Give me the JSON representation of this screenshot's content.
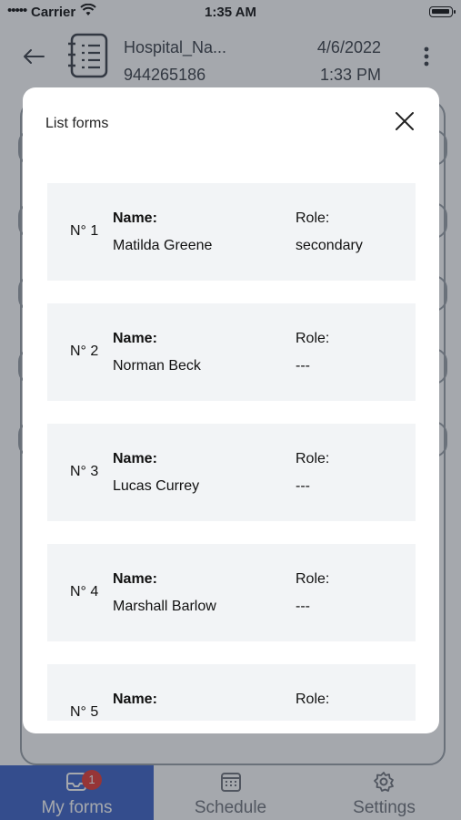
{
  "status_bar": {
    "carrier": "Carrier",
    "time": "1:35 AM"
  },
  "header": {
    "name": "Hospital_Na...",
    "id": "944265186",
    "date": "4/6/2022",
    "time": "1:33 PM"
  },
  "modal": {
    "title": "List forms",
    "items": [
      {
        "number": "N° 1",
        "name_label": "Name:",
        "name": "Matilda  Greene",
        "role_label": "Role:",
        "role": "secondary"
      },
      {
        "number": "N° 2",
        "name_label": "Name:",
        "name": "Norman Beck",
        "role_label": "Role:",
        "role": "---"
      },
      {
        "number": "N° 3",
        "name_label": "Name:",
        "name": "Lucas  Currey",
        "role_label": "Role:",
        "role": "---"
      },
      {
        "number": "N° 4",
        "name_label": "Name:",
        "name": "Marshall  Barlow",
        "role_label": "Role:",
        "role": "---"
      },
      {
        "number": "N° 5",
        "name_label": "Name:",
        "name": "",
        "role_label": "Role:",
        "role": ""
      }
    ]
  },
  "tabbar": {
    "tabs": [
      {
        "label": "My forms",
        "badge": "1"
      },
      {
        "label": "Schedule"
      },
      {
        "label": "Settings"
      }
    ]
  },
  "colors": {
    "accent": "#3d63c9",
    "badge": "#e53935",
    "item_bg": "#f2f4f6"
  }
}
